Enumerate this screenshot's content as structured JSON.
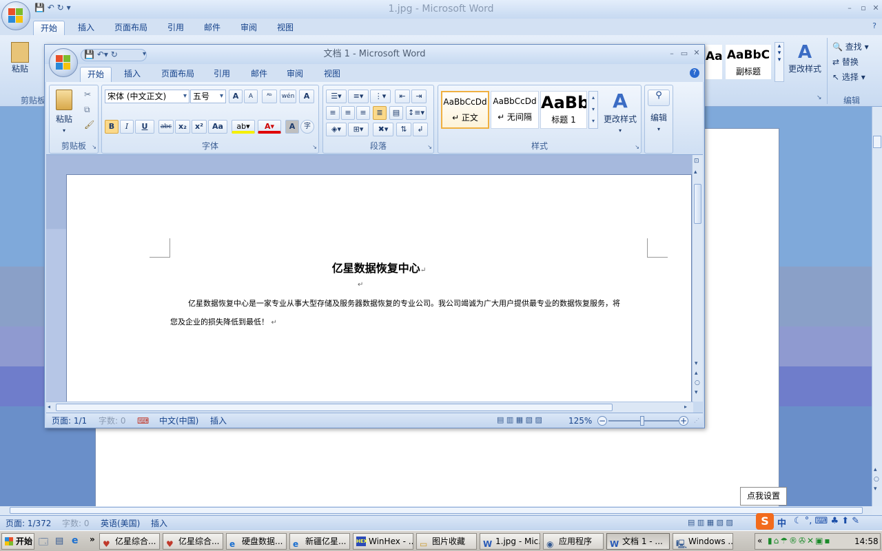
{
  "background_window": {
    "title": "1.jpg - Microsoft Word",
    "tabs": [
      "开始",
      "插入",
      "页面布局",
      "引用",
      "邮件",
      "审阅",
      "视图"
    ],
    "ribbon_visible": {
      "paste_label": "粘贴",
      "clipboard_label": "剪贴板",
      "style_cards": [
        "AaBbC",
        "AaBbC"
      ],
      "subtitle_style": "副标题",
      "change_styles": "更改样式",
      "find": "查找",
      "replace": "替换",
      "select": "选择",
      "edit_group": "编辑"
    },
    "status": {
      "page": "页面: 1/372",
      "words": "字数: 0",
      "lang": "英语(美国)",
      "mode": "插入"
    }
  },
  "foreground_window": {
    "title": "文档 1 - Microsoft Word",
    "tabs": [
      "开始",
      "插入",
      "页面布局",
      "引用",
      "邮件",
      "审阅",
      "视图"
    ],
    "clipboard": {
      "paste": "粘贴",
      "label": "剪贴板"
    },
    "font": {
      "name": "宋体 (中文正文)",
      "size": "五号",
      "label": "字体",
      "bold": "B",
      "italic": "I",
      "underline": "U",
      "strike": "abc",
      "sub": "x₂",
      "sup": "x²",
      "case": "Aa",
      "grow": "A",
      "shrink": "A",
      "wen": "wén",
      "char_border": "A",
      "char_shade": "A",
      "enclose": "字"
    },
    "paragraph": {
      "label": "段落"
    },
    "styles": {
      "label": "样式",
      "cards": [
        {
          "preview": "AaBbCcDd",
          "name": "↵ 正文"
        },
        {
          "preview": "AaBbCcDd",
          "name": "↵ 无间隔"
        },
        {
          "preview": "AaBb",
          "name": "标题 1"
        }
      ],
      "change": "更改样式"
    },
    "edit": {
      "label": "编辑"
    },
    "document": {
      "title": "亿星数据恢复中心",
      "body_line1": "亿星数据恢复中心是一家专业从事大型存储及服务器数据恢复的专业公司。我公司竭诚为广大用户提供最专业的数据恢复服务，将",
      "body_line2": "您及企业的损失降低到最低！",
      "para_mark": "↵"
    },
    "status": {
      "page": "页面: 1/1",
      "words": "字数: 0",
      "lang": "中文(中国)",
      "mode": "插入",
      "zoom": "125%"
    }
  },
  "tooltip": "点我设置",
  "taskbar": {
    "start": "开始",
    "more": "»",
    "tasks": [
      "亿星综合...",
      "亿星综合...",
      "硬盘数据...",
      "新疆亿星...",
      "WinHex - ...",
      "图片收藏",
      "1.jpg - Mic...",
      "应用程序",
      "文档 1 - ...",
      "Windows ..."
    ],
    "ime": "中",
    "clock": "14:58",
    "expand": "«"
  }
}
